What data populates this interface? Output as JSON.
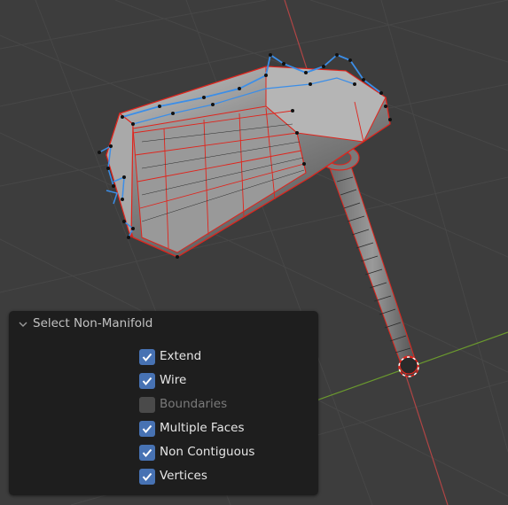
{
  "panel": {
    "title": "Select Non-Manifold",
    "collapse_icon": "chevron-down-icon",
    "options": [
      {
        "label": "Extend",
        "checked": true,
        "enabled": true
      },
      {
        "label": "Wire",
        "checked": true,
        "enabled": true
      },
      {
        "label": "Boundaries",
        "checked": false,
        "enabled": false
      },
      {
        "label": "Multiple Faces",
        "checked": true,
        "enabled": true
      },
      {
        "label": "Non Contiguous",
        "checked": true,
        "enabled": true
      },
      {
        "label": "Vertices",
        "checked": true,
        "enabled": true
      }
    ]
  },
  "colors": {
    "viewport_bg": "#3d3d3d",
    "grid": "#474747",
    "x_axis": "#b04545",
    "y_axis": "#6b9a2e",
    "mesh_face": "#8a8a8a",
    "selected_edge": "#e0241c",
    "boundary_edge": "#3b8ee8",
    "checkbox_on": "#4772b3",
    "panel_bg": "#1e1e1e"
  }
}
